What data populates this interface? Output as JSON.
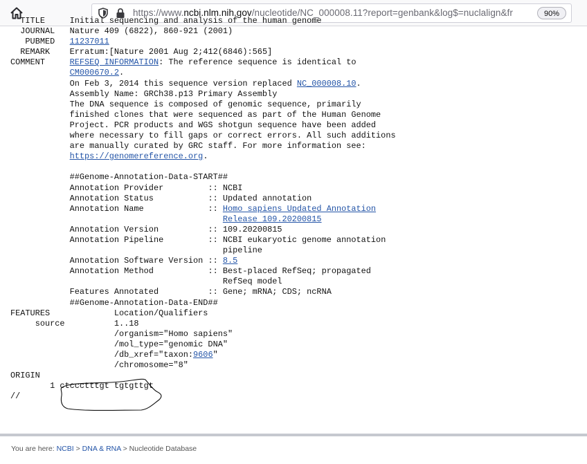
{
  "browser": {
    "url_prefix": "https://www.",
    "url_host": "ncbi.nlm.nih.gov",
    "url_path": "/nucleotide/NC_000008.11?report=genbank&log$=nuclalign&fr",
    "zoom": "90%"
  },
  "record": {
    "title_cont": "Initial sequencing and analysis of the human genome",
    "journal_key": "JOURNAL",
    "journal": "Nature 409 (6822), 860-921 (2001)",
    "pubmed_key": "PUBMED",
    "pubmed_link": "11237011",
    "remark_key": "REMARK",
    "remark": "Erratum:[Nature 2001 Aug 2;412(6846):565]",
    "comment_key": "COMMENT",
    "refseq_link": "REFSEQ INFORMATION",
    "refseq_text": ": The reference sequence is identical to",
    "cm_link": "CM000670.2",
    "replaced_text": "On Feb 3, 2014 this sequence version replaced ",
    "nc_link": "NC_000008.10",
    "assembly": "Assembly Name: GRCh38.p13 Primary Assembly",
    "desc_lines": [
      "The DNA sequence is composed of genomic sequence, primarily",
      "finished clones that were sequenced as part of the Human Genome",
      "Project. PCR products and WGS shotgun sequence have been added",
      "where necessary to fill gaps or correct errors. All such additions",
      "are manually curated by GRC staff. For more information see:"
    ],
    "grc_link": "https://genomereference.org",
    "annot_start": "##Genome-Annotation-Data-START##",
    "annot_provider_key": "Annotation Provider        ",
    "annot_provider": "NCBI",
    "annot_status_key": "Annotation Status          ",
    "annot_status": "Updated annotation",
    "annot_name_key": "Annotation Name            ",
    "annot_name_link1": "Homo sapiens Updated Annotation",
    "annot_name_link2": "Release 109.20200815",
    "annot_version_key": "Annotation Version         ",
    "annot_version": "109.20200815",
    "annot_pipeline_key": "Annotation Pipeline        ",
    "annot_pipeline1": "NCBI eukaryotic genome annotation",
    "annot_pipeline2": "pipeline",
    "annot_software_key": "Annotation Software Version",
    "annot_software_link": "8.5",
    "annot_method_key": "Annotation Method          ",
    "annot_method1": "Best-placed RefSeq; propagated",
    "annot_method2": "RefSeq model",
    "features_annotated_key": "Features Annotated         ",
    "features_annotated": "Gene; mRNA; CDS; ncRNA",
    "annot_end": "##Genome-Annotation-Data-END##",
    "features_key": "FEATURES",
    "location_header": "Location/Qualifiers",
    "source_key": "source",
    "source_range": "1..18",
    "organism": "/organism=\"Homo sapiens\"",
    "mol_type": "/mol_type=\"genomic DNA\"",
    "db_xref_pre": "/db_xref=\"taxon:",
    "taxon_link": "9606",
    "db_xref_post": "\"",
    "chromosome": "/chromosome=\"8\"",
    "origin_key": "ORIGIN",
    "seq_index": "1",
    "sequence": "ctccctttgt tgtgttgt",
    "terminator": "//"
  },
  "footer": {
    "you_are_here": "You are here: ",
    "crumb1": "NCBI",
    "crumb2": "DNA & RNA",
    "crumb3": "Nucleotide Database",
    "sep": " > "
  },
  "colors": {
    "link": "#2354a7",
    "text": "#111111"
  }
}
